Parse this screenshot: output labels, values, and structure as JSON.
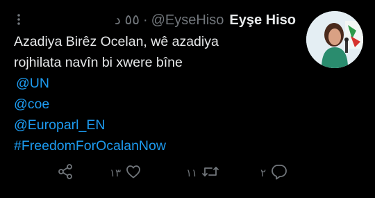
{
  "author": {
    "display_name": "Eyşe Hiso",
    "handle": "@EyseHiso",
    "timestamp": "٥٥ د",
    "separator": "·"
  },
  "tweet": {
    "line1": "Azadiya Birêz Ocelan, wê azadiya",
    "line2": "rojhilata navîn bi xwere bîne",
    "mentions": [
      "@UN",
      "@coe",
      "@Europarl_EN"
    ],
    "hashtag": "#FreedomForOcalanNow"
  },
  "actions": {
    "likes": "١٣",
    "retweets": "١١",
    "replies": "٢"
  },
  "icons": {
    "more": "more-vertical-icon",
    "share": "share-icon",
    "like": "heart-icon",
    "retweet": "retweet-icon",
    "reply": "reply-icon"
  },
  "colors": {
    "background": "#000000",
    "text": "#e7e9ea",
    "muted": "#71767b",
    "link": "#1d9bf0"
  }
}
